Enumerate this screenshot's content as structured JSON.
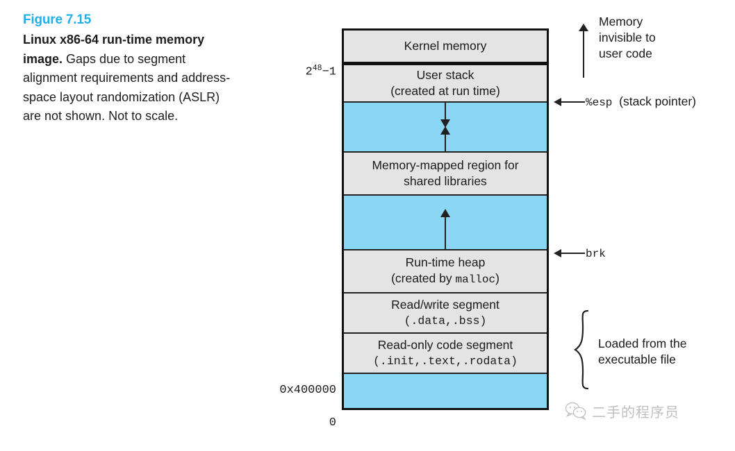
{
  "caption": {
    "figure_number": "Figure 7.15",
    "title": "Linux x86-64 run-time memory image.",
    "body": " Gaps due to segment alignment requirements and address-space layout randomization (ASLR) are not shown. Not to scale."
  },
  "colors": {
    "figure_number": "#22b0e8",
    "gap_fill": "#89d6f5",
    "segment_fill": "#e4e4e4",
    "outline": "#111111"
  },
  "diagram": {
    "blocks": [
      {
        "id": "kernel-memory",
        "label": "Kernel memory",
        "sublabel": "",
        "fill": "segment"
      },
      {
        "id": "user-stack",
        "label": "User stack",
        "sublabel": "(created at run time)",
        "fill": "segment"
      },
      {
        "id": "stack-gap",
        "label": "",
        "sublabel": "",
        "fill": "gap"
      },
      {
        "id": "memory-mapped",
        "label": "Memory-mapped region for",
        "sublabel": "shared libraries",
        "fill": "segment"
      },
      {
        "id": "heap-gap",
        "label": "",
        "sublabel": "",
        "fill": "gap"
      },
      {
        "id": "run-time-heap",
        "label": "Run-time heap",
        "sublabel_pre": "(created by ",
        "sublabel_mono": "malloc",
        "sublabel_post": ")",
        "fill": "segment"
      },
      {
        "id": "read-write-segment",
        "label": "Read/write segment",
        "sublabel_mono": "(.data,.bss)",
        "fill": "segment"
      },
      {
        "id": "read-only-segment",
        "label": "Read-only code segment",
        "sublabel_mono": "(.init,.text,.rodata)",
        "fill": "segment"
      },
      {
        "id": "low-reserved",
        "label": "",
        "sublabel": "",
        "fill": "gap"
      }
    ]
  },
  "address_labels": {
    "top": {
      "base": "2",
      "exponent": "48",
      "suffix": "−1"
    },
    "code_start": "0x400000",
    "zero": "0"
  },
  "annotations": {
    "kernel_note_line1": "Memory",
    "kernel_note_line2": "invisible to",
    "kernel_note_line3": "user code",
    "esp_register": "%esp",
    "esp_description": "(stack pointer)",
    "brk_register": "brk",
    "loaded_line1": "Loaded from the",
    "loaded_line2": "executable file"
  },
  "watermark": {
    "icon": "wechat-icon",
    "text": "二手的程序员"
  }
}
